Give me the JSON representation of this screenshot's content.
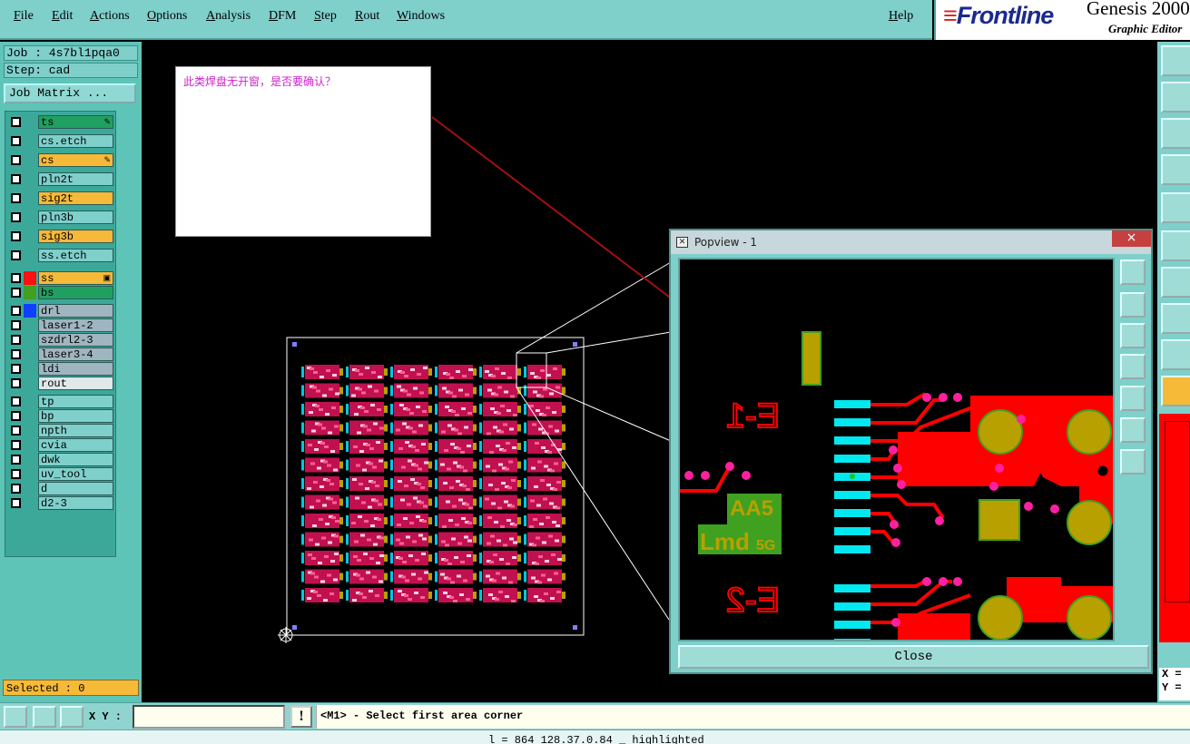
{
  "menu": [
    "File",
    "Edit",
    "Actions",
    "Options",
    "Analysis",
    "DFM",
    "Step",
    "Rout",
    "Windows"
  ],
  "help": "Help",
  "brand": {
    "logo": "Frontline",
    "product": "Genesis 2000",
    "subtitle": "Graphic Editor"
  },
  "job": {
    "job_label": "Job : 4s7bl1pqa0",
    "step_label": "Step: cad",
    "matrix_button": "Job Matrix ..."
  },
  "layers": [
    {
      "name": "ts",
      "color": "#20a060",
      "swatch": "",
      "flag": "✎"
    },
    {
      "name": "cs.etch",
      "color": "#7fcfcb",
      "swatch": "",
      "flag": ""
    },
    {
      "name": "cs",
      "color": "#f6b938",
      "swatch": "",
      "flag": "✎"
    },
    {
      "name": "pln2t",
      "color": "#7fcfcb",
      "swatch": "",
      "flag": ""
    },
    {
      "name": "sig2t",
      "color": "#f6b938",
      "swatch": "",
      "flag": ""
    },
    {
      "name": "pln3b",
      "color": "#7fcfcb",
      "swatch": "",
      "flag": ""
    },
    {
      "name": "sig3b",
      "color": "#f6b938",
      "swatch": "",
      "flag": ""
    },
    {
      "name": "ss.etch",
      "color": "#7fcfcb",
      "swatch": "",
      "flag": ""
    },
    {
      "name": "ss",
      "color": "#f6b938",
      "swatch": "#ff1010",
      "flag": "▣"
    },
    {
      "name": "bs",
      "color": "#20a060",
      "swatch": "#40a020",
      "flag": ""
    },
    {
      "name": "drl",
      "color": "#9fb5c0",
      "swatch": "#1040ff",
      "flag": ""
    },
    {
      "name": "laser1-2",
      "color": "#9fb5c0",
      "swatch": "",
      "flag": ""
    },
    {
      "name": "szdrl2-3",
      "color": "#9fb5c0",
      "swatch": "",
      "flag": ""
    },
    {
      "name": "laser3-4",
      "color": "#9fb5c0",
      "swatch": "",
      "flag": ""
    },
    {
      "name": "ldi",
      "color": "#9fb5c0",
      "swatch": "",
      "flag": ""
    },
    {
      "name": "rout",
      "color": "#e0e8e8",
      "swatch": "",
      "flag": ""
    },
    {
      "name": "tp",
      "color": "#7fcfcb",
      "swatch": "",
      "flag": ""
    },
    {
      "name": "bp",
      "color": "#7fcfcb",
      "swatch": "",
      "flag": ""
    },
    {
      "name": "npth",
      "color": "#7fcfcb",
      "swatch": "",
      "flag": ""
    },
    {
      "name": "cvia",
      "color": "#7fcfcb",
      "swatch": "",
      "flag": ""
    },
    {
      "name": "dwk",
      "color": "#7fcfcb",
      "swatch": "",
      "flag": ""
    },
    {
      "name": "uv_tool",
      "color": "#7fcfcb",
      "swatch": "",
      "flag": ""
    },
    {
      "name": "d",
      "color": "#7fcfcb",
      "swatch": "",
      "flag": ""
    },
    {
      "name": "d2-3",
      "color": "#7fcfcb",
      "swatch": "",
      "flag": ""
    }
  ],
  "selected": "Selected : 0",
  "note_text": "此类焊盘无开窗，是否要确认？",
  "popview": {
    "title": "Popview - 1",
    "close_x": "×",
    "close_button": "Close",
    "labels": {
      "e1": "E-1",
      "e2": "E-2",
      "aa5": "AA5",
      "lmd": "Lmd",
      "sg": "5G"
    }
  },
  "bottom": {
    "xy_label": "X Y :",
    "xy_value": "",
    "excl": "!",
    "prompt": "<M1> - Select first area corner"
  },
  "coords": {
    "x": "X =",
    "y": "Y ="
  },
  "status_line": "l         = 864    128.37.0.84   _         highlighted"
}
